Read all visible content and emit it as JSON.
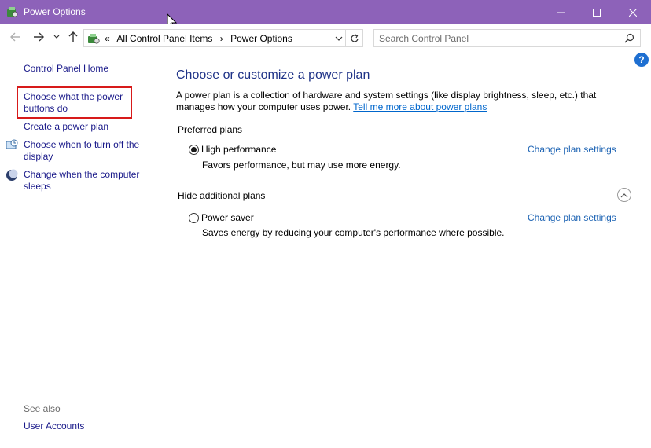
{
  "window": {
    "title": "Power Options"
  },
  "address": {
    "overflow": "«",
    "crumbs": [
      "All Control Panel Items",
      "Power Options"
    ]
  },
  "search": {
    "placeholder": "Search Control Panel"
  },
  "help": {
    "label": "?"
  },
  "sidebar": {
    "home": "Control Panel Home",
    "items": [
      {
        "label_line1": "Choose what the power",
        "label_line2": "buttons do"
      },
      {
        "label_line1": "Create a power plan"
      },
      {
        "label_line1": "Choose when to turn off the",
        "label_line2": "display"
      },
      {
        "label_line1": "Change when the computer",
        "label_line2": "sleeps"
      }
    ],
    "see_also": "See also",
    "user_accounts": "User Accounts"
  },
  "main": {
    "title": "Choose or customize a power plan",
    "description": "A power plan is a collection of hardware and system settings (like display brightness, sleep, etc.) that manages how your computer uses power.",
    "learn_more": "Tell me more about power plans",
    "preferred_header": "Preferred plans",
    "hidden_header": "Hide additional plans",
    "plans": [
      {
        "name": "High performance",
        "description": "Favors performance, but may use more energy.",
        "selected": true,
        "change_label": "Change plan settings"
      },
      {
        "name": "Power saver",
        "description": "Saves energy by reducing your computer's performance where possible.",
        "selected": false,
        "change_label": "Change plan settings"
      }
    ]
  },
  "colors": {
    "titlebar": "#8d62b9",
    "link": "#1e64b4",
    "heading": "#1e3287",
    "highlight_box": "#d71a1a"
  }
}
